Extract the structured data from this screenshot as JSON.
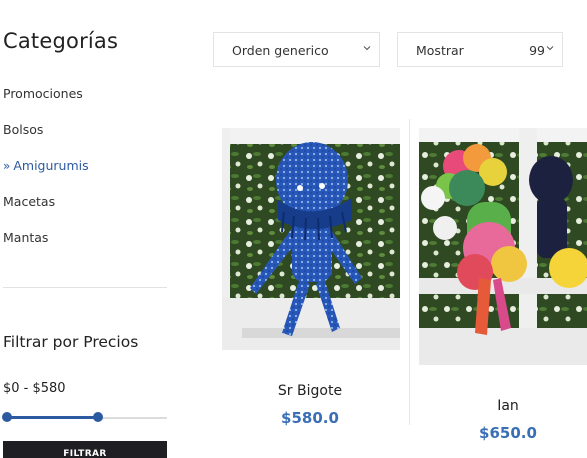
{
  "sidebar": {
    "title": "Categorías",
    "categories": [
      {
        "label": "Promociones",
        "active": false
      },
      {
        "label": "Bolsos",
        "active": false
      },
      {
        "label": "Amigurumis",
        "active": true
      },
      {
        "label": "Macetas",
        "active": false
      },
      {
        "label": "Mantas",
        "active": false
      }
    ],
    "price_filter": {
      "title": "Filtrar por Precios",
      "range_label": "$0 - $580",
      "min": 0,
      "max": 580,
      "fill_fraction": 0.57,
      "button_label": "FILTRAR"
    }
  },
  "toolbar": {
    "sort_label": "Orden generico",
    "show_label": "Mostrar",
    "show_value": "99"
  },
  "products": [
    {
      "name": "Sr Bigote",
      "price": "$580.0"
    },
    {
      "name": "Ian",
      "price": "$650.0"
    }
  ],
  "colors": {
    "accent": "#2c5aa0",
    "price": "#3b6fb5",
    "button": "#1f1f23"
  }
}
